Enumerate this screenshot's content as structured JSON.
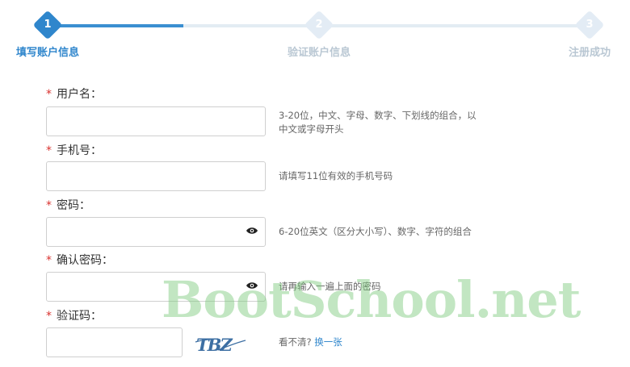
{
  "stepper": {
    "steps": [
      {
        "number": "1",
        "label": "填写账户信息",
        "state": "active"
      },
      {
        "number": "2",
        "label": "验证账户信息",
        "state": "inactive"
      },
      {
        "number": "3",
        "label": "注册成功",
        "state": "inactive"
      }
    ]
  },
  "form": {
    "required_mark": "*",
    "username": {
      "label": "用户名：",
      "value": "",
      "hint_line1": "3-20位，中文、字母、数字、下划线的组合，以",
      "hint_line2": "中文或字母开头"
    },
    "phone": {
      "label": "手机号：",
      "value": "",
      "hint": "请填写11位有效的手机号码"
    },
    "password": {
      "label": "密码：",
      "value": "",
      "hint": "6-20位英文（区分大小写）、数字、字符的组合"
    },
    "confirm_password": {
      "label": "确认密码：",
      "value": "",
      "hint": "请再输入一遍上面的密码"
    },
    "captcha": {
      "label": "验证码：",
      "value": "",
      "image_text": "TBZ",
      "hint_prefix": "看不清?",
      "refresh_link": "换一张"
    }
  },
  "watermark": "BootSchool.net",
  "colors": {
    "accent": "#2f86cc",
    "required": "#d9322f",
    "inactive_step": "#e3ecf5"
  }
}
